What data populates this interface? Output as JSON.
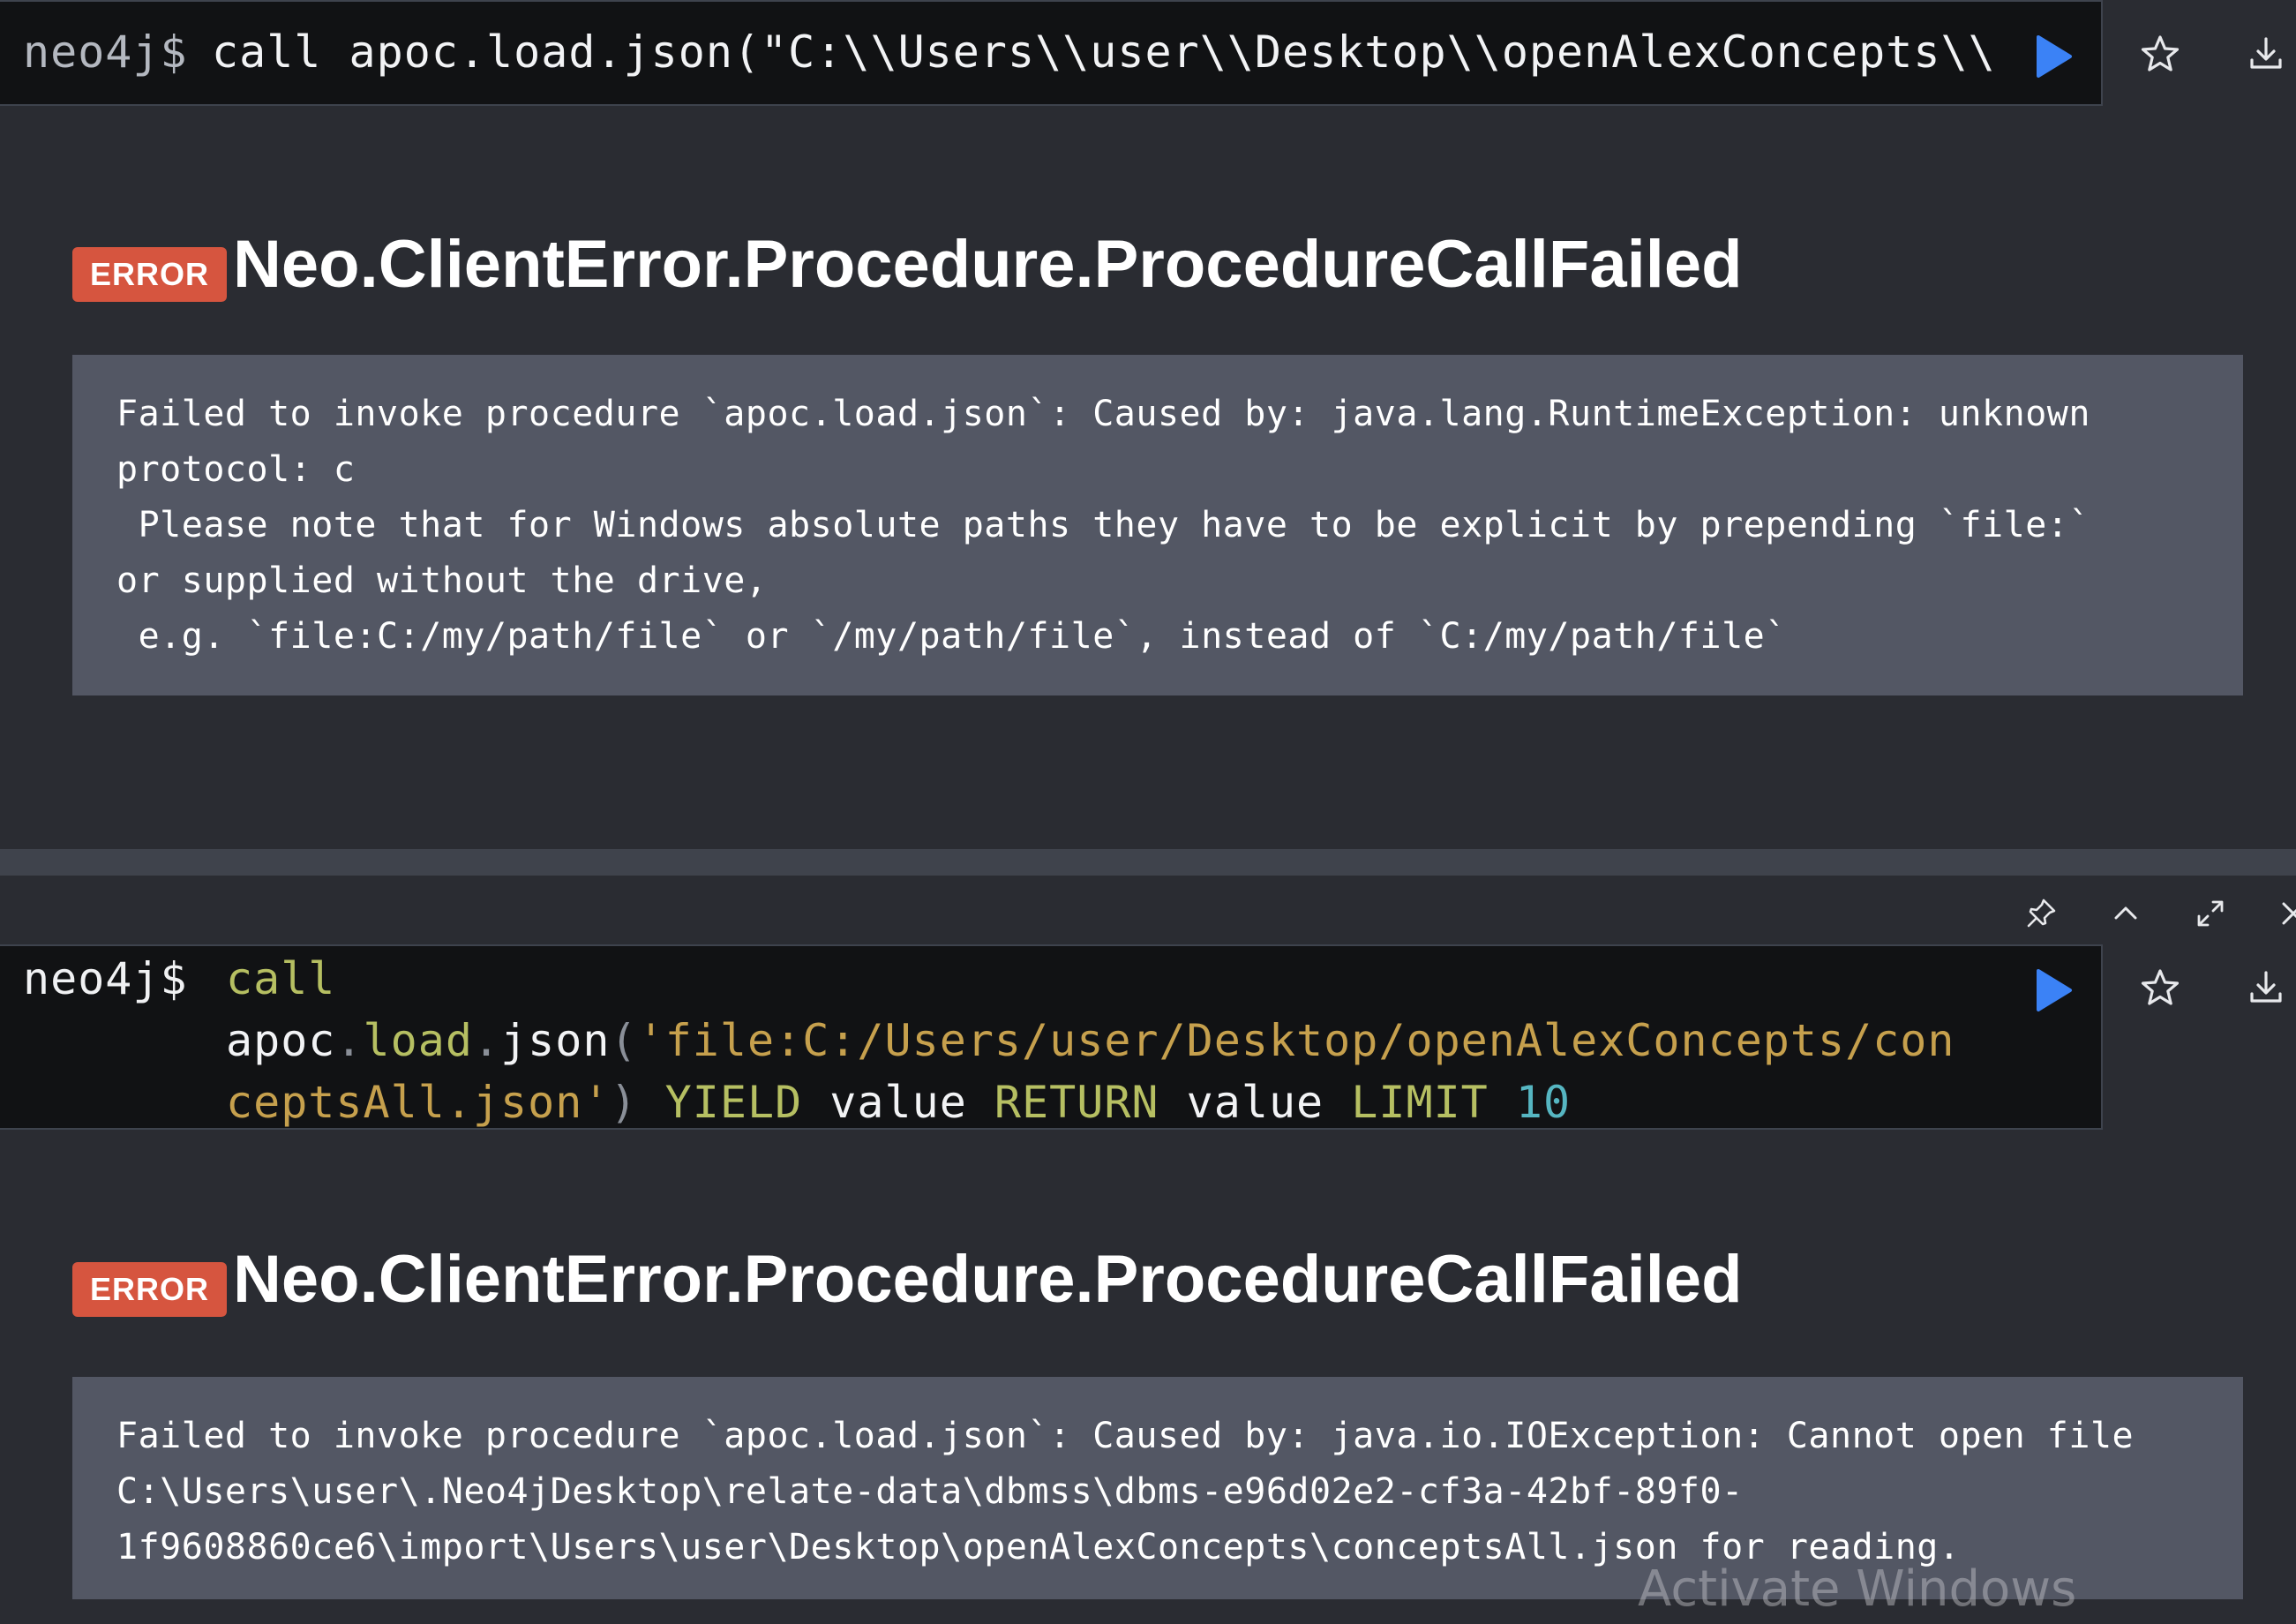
{
  "frame1": {
    "prompt": "neo4j$",
    "query": "call apoc.load.json(\"C:\\\\Users\\\\user\\\\Desktop\\\\openAlexConcepts\\\\…",
    "error": {
      "badge": "ERROR",
      "title": "Neo.ClientError.Procedure.ProcedureCallFailed",
      "lines": [
        "Failed to invoke procedure `apoc.load.json`: Caused by: java.lang.RuntimeException: unknown",
        "protocol: c",
        " Please note that for Windows absolute paths they have to be explicit by prepending `file:`",
        "or supplied without the drive,",
        " e.g. `file:C:/my/path/file` or `/my/path/file`, instead of `C:/my/path/file`"
      ]
    }
  },
  "frame2": {
    "prompt": "neo4j$",
    "query_tokens": {
      "call": "call",
      "apoc": "apoc",
      "dot1": ".",
      "load": "load",
      "dot2": ".",
      "json": "json",
      "paren_open": "(",
      "string_part1": "'file:C:/Users/user/Desktop/openAlexConcepts/con",
      "string_part2": "ceptsAll.json'",
      "paren_close": ")",
      "yield": "YIELD",
      "value1": "value",
      "return": "RETURN",
      "value2": "value",
      "limit": "LIMIT",
      "limit_value": "10"
    },
    "error": {
      "badge": "ERROR",
      "title": "Neo.ClientError.Procedure.ProcedureCallFailed",
      "lines": [
        "Failed to invoke procedure `apoc.load.json`: Caused by: java.io.IOException: Cannot open file",
        "C:\\Users\\user\\.Neo4jDesktop\\relate-data\\dbmss\\dbms-e96d02e2-cf3a-42bf-89f0-",
        "1f9608860ce6\\import\\Users\\user\\Desktop\\openAlexConcepts\\conceptsAll.json for reading."
      ]
    }
  },
  "icons": {
    "run": "play-icon",
    "favorite": "star-icon",
    "download": "download-icon",
    "pin": "pin-icon",
    "collapse": "chevron-up-icon",
    "expand": "expand-icon",
    "close": "close-icon"
  },
  "colors": {
    "accent_blue": "#3b82f6",
    "error_red": "#d6553f",
    "keyword": "#b6bf62",
    "string": "#c6a04d",
    "number": "#56b6c2"
  },
  "watermark": "Activate Windows"
}
